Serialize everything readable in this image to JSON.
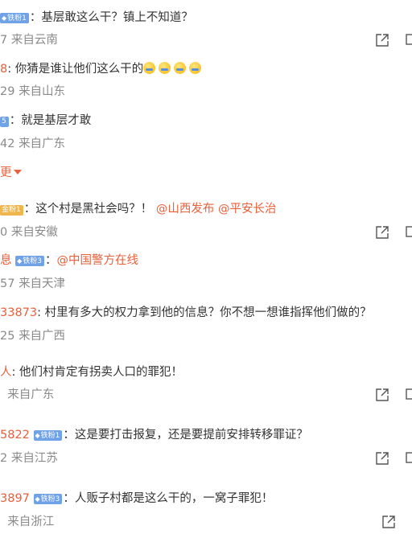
{
  "comments": [
    {
      "user": "",
      "badge": "铁粉1",
      "text": "：基层敢这么干？镇上不知道？",
      "meta_num": "7",
      "location": "来自云南"
    },
    {
      "user": "8",
      "text": ": 你猜是谁让他们这么干的",
      "meta_num": "29",
      "location": "来自山东"
    },
    {
      "user": "",
      "badge": "5",
      "text": "：就是基层才敢",
      "meta_num": "42",
      "location": "来自广东"
    },
    {
      "badge": "金粉1",
      "text": "：这个村是黑社会吗？！",
      "mention1": "@山西发布",
      "mention2": "@平安长治",
      "meta_num": "0",
      "location": "来自安徽"
    },
    {
      "user": "息",
      "badge": "铁粉3",
      "text": "：",
      "mention1": "@中国警方在线",
      "meta_num": "57",
      "location": "来自天津"
    },
    {
      "user": "33873",
      "text": ": 村里有多大的权力拿到他的信息？你不想一想谁指挥他们做的？",
      "meta_num": "25",
      "location": "来自广西"
    },
    {
      "user": "人",
      "text": ": 他们村肯定有拐卖人口的罪犯！",
      "meta_num": "",
      "location": "来自广东"
    },
    {
      "user": "5822",
      "badge": "铁粉1",
      "text": "：这是要打击报复，还是要提前安排转移罪证？",
      "meta_num": "2",
      "location": "来自江苏"
    },
    {
      "user": "3897",
      "badge": "铁粉3",
      "text": "：人贩子村都是这么干的，一窝子罪犯！",
      "meta_num": "",
      "location": "来自浙江"
    }
  ],
  "expand_label": "更",
  "icons": {
    "share": "share-icon",
    "comment": "comment-icon",
    "expand": "caret-down-icon",
    "emoji": "laugh-cry-emoji"
  },
  "colors": {
    "username": "#e8603c",
    "badge": "#6fa2e6",
    "meta": "#8a8a8a"
  }
}
